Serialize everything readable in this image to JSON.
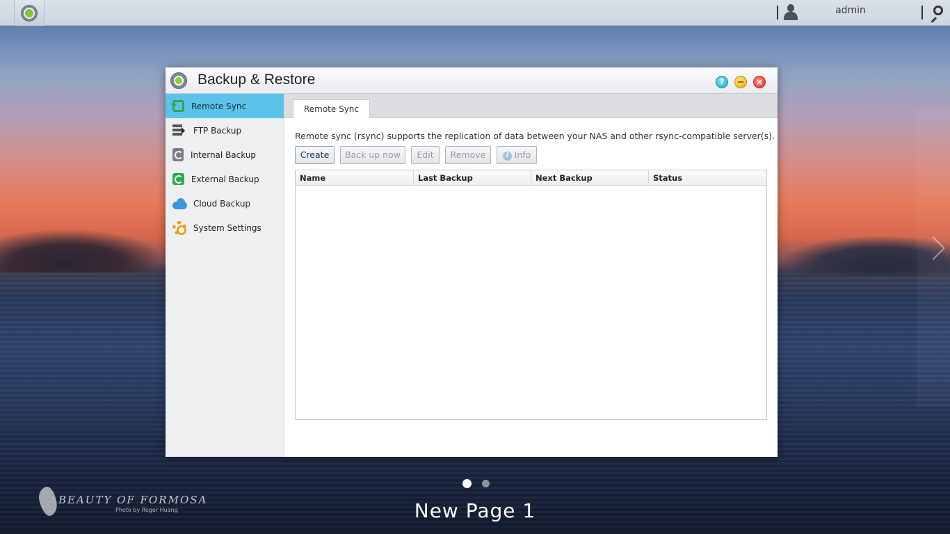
{
  "topbar": {
    "user": "admin",
    "icons": [
      "app-logo-icon",
      "user-icon",
      "search-icon"
    ]
  },
  "window": {
    "title": "Backup & Restore",
    "controls": {
      "help": "?",
      "close": "×"
    },
    "sidebar": {
      "items": [
        {
          "label": "Remote Sync",
          "icon": "remote-sync-icon",
          "active": true
        },
        {
          "label": "FTP Backup",
          "icon": "ftp-backup-icon",
          "active": false
        },
        {
          "label": "Internal Backup",
          "icon": "internal-backup-icon",
          "active": false
        },
        {
          "label": "External Backup",
          "icon": "external-backup-icon",
          "active": false
        },
        {
          "label": "Cloud Backup",
          "icon": "cloud-backup-icon",
          "active": false
        },
        {
          "label": "System Settings",
          "icon": "gear-icon",
          "active": false
        }
      ]
    },
    "main": {
      "tab": "Remote Sync",
      "description": "Remote sync (rsync) supports the replication of data between your NAS and other rsync-compatible server(s).",
      "buttons": {
        "create": "Create",
        "backup_now": "Back up now",
        "edit": "Edit",
        "remove": "Remove",
        "info": "Info",
        "info_glyph": "i"
      },
      "table": {
        "columns": [
          "Name",
          "Last Backup",
          "Next Backup",
          "Status"
        ],
        "rows": []
      }
    }
  },
  "desktop": {
    "page_label": "New Page 1",
    "pages": 2,
    "current_page": 1,
    "watermark_title": "BEAUTY OF FORMOSA",
    "watermark_credit": "Photo by Roger Huang"
  },
  "colors": {
    "active_nav": "#5bc3ea",
    "close": "#e0312a",
    "minimize": "#e7ad14",
    "help": "#1fa7c2"
  }
}
